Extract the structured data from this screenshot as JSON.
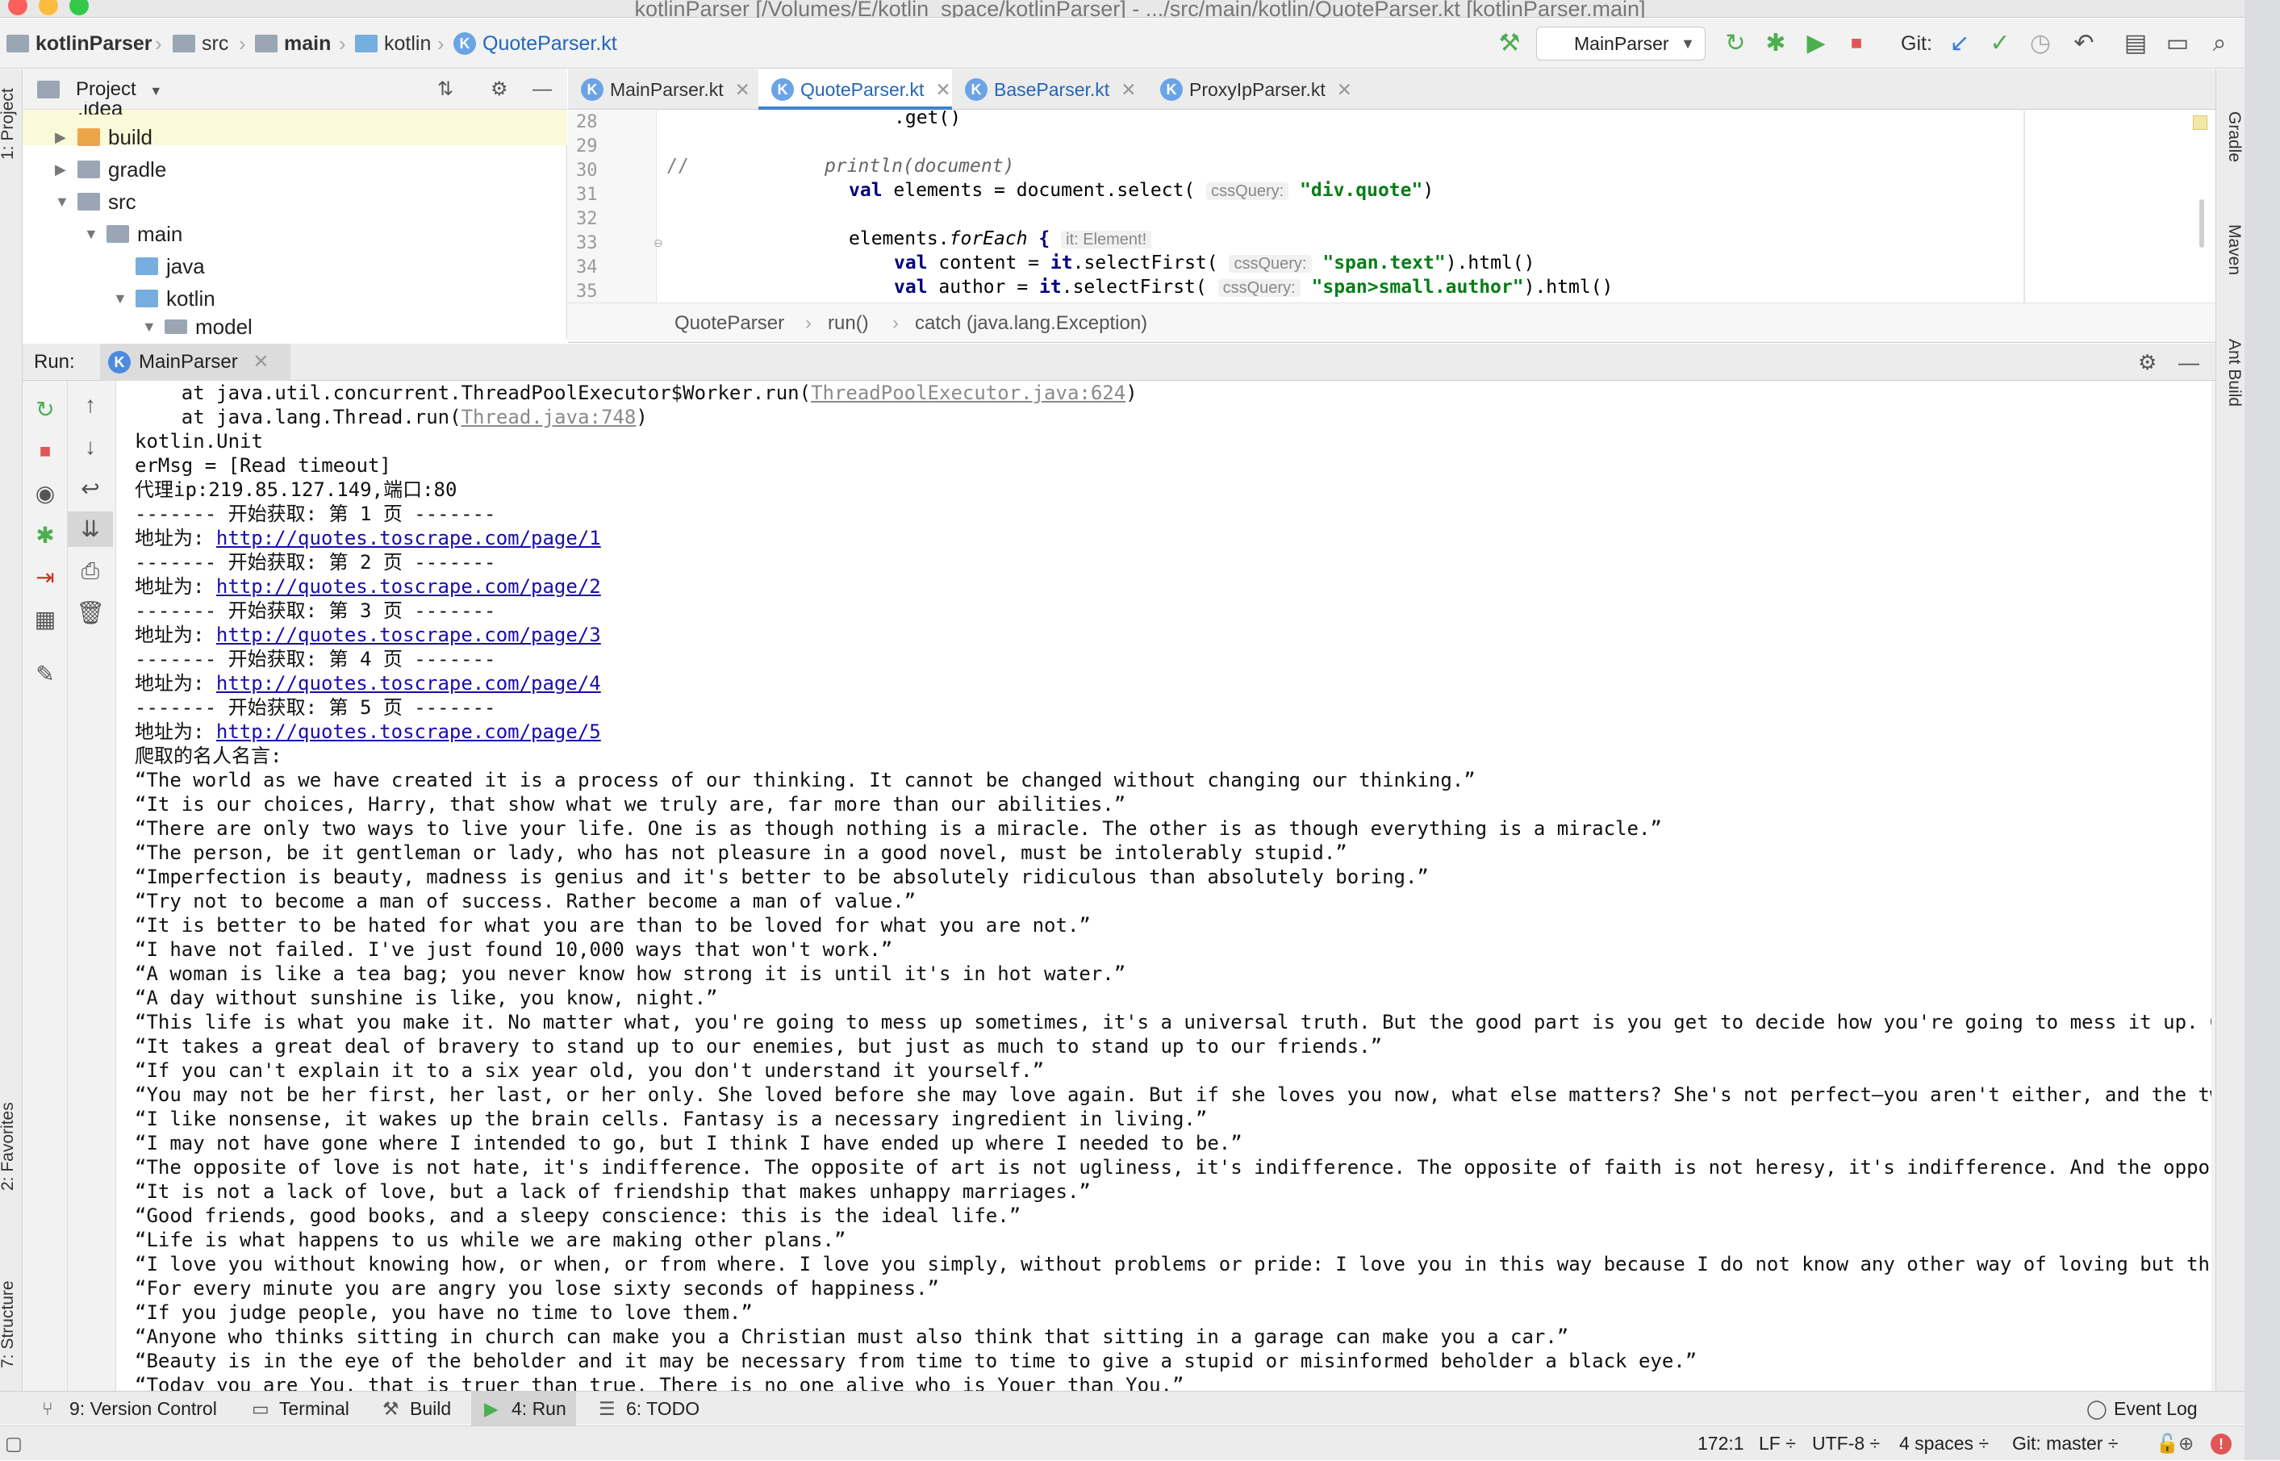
{
  "window": {
    "title": "kotlinParser [/Volumes/E/kotlin_space/kotlinParser] - .../src/main/kotlin/QuoteParser.kt [kotlinParser.main]"
  },
  "nav": {
    "project": "kotlinParser",
    "crumbs": [
      "src",
      "main",
      "kotlin",
      "QuoteParser.kt"
    ]
  },
  "toolbar": {
    "run_config": "MainParser",
    "git_label": "Git:"
  },
  "left_strip": {
    "project": "1: Project",
    "favorites": "2: Favorites",
    "structure": "7: Structure"
  },
  "right_strip": {
    "gradle": "Gradle",
    "maven": "Maven",
    "ant": "Ant Build"
  },
  "project": {
    "title": "Project",
    "tree": [
      {
        "label": ".idea",
        "type": "folder"
      },
      {
        "label": "build",
        "type": "folder-orange"
      },
      {
        "label": "gradle",
        "type": "folder"
      },
      {
        "label": "src",
        "type": "folder"
      },
      {
        "label": "main",
        "type": "folder"
      },
      {
        "label": "java",
        "type": "folder-blue"
      },
      {
        "label": "kotlin",
        "type": "folder-blue"
      },
      {
        "label": "model",
        "type": "package"
      }
    ]
  },
  "editor": {
    "tabs": [
      "MainParser.kt",
      "QuoteParser.kt",
      "BaseParser.kt",
      "ProxyIpParser.kt"
    ],
    "active_tab": 1,
    "line_numbers": [
      "28",
      "29",
      "30",
      "31",
      "32",
      "33",
      "34",
      "35"
    ],
    "code": {
      "l28": ".get()",
      "l30_comment": "//",
      "l30_code": "println(document)",
      "l31_kw": "val",
      "l31_a": "elements = document.select(",
      "l31_hint": "cssQuery:",
      "l31_str": "\"div.quote\"",
      "l31_b": ")",
      "l33_a": "elements.",
      "l33_fn": "forEach",
      "l33_b": " {",
      "l33_hint": "it: Element!",
      "l34_kw": "val",
      "l34_a": "content = ",
      "l34_it": "it",
      "l34_b": ".selectFirst(",
      "l34_hint": "cssQuery:",
      "l34_str": "\"span.text\"",
      "l34_c": ").html()",
      "l35_kw": "val",
      "l35_a": "author = ",
      "l35_it": "it",
      "l35_b": ".selectFirst(",
      "l35_hint": "cssQuery:",
      "l35_str": "\"span>small.author\"",
      "l35_c": ").html()"
    },
    "breadcrumb": [
      "QuoteParser",
      "run()",
      "catch (java.lang.Exception)"
    ]
  },
  "run": {
    "label": "Run:",
    "tab": "MainParser",
    "console": [
      {
        "pre": "    at java.util.concurrent.ThreadPoolExecutor$Worker.run(",
        "link": "ThreadPoolExecutor.java:624",
        "post": ")",
        "style": "gray"
      },
      {
        "pre": "    at java.lang.Thread.run(",
        "link": "Thread.java:748",
        "post": ")",
        "style": "gray"
      },
      {
        "pre": "kotlin.Unit"
      },
      {
        "pre": "erMsg = [Read timeout]"
      },
      {
        "pre": "代理ip:219.85.127.149,端口:80"
      },
      {
        "pre": "------- 开始获取: 第 1 页 -------"
      },
      {
        "pre": "地址为: ",
        "link": "http://quotes.toscrape.com/page/1",
        "style": "link"
      },
      {
        "pre": "------- 开始获取: 第 2 页 -------"
      },
      {
        "pre": "地址为: ",
        "link": "http://quotes.toscrape.com/page/2",
        "style": "link"
      },
      {
        "pre": "------- 开始获取: 第 3 页 -------"
      },
      {
        "pre": "地址为: ",
        "link": "http://quotes.toscrape.com/page/3",
        "style": "link"
      },
      {
        "pre": "------- 开始获取: 第 4 页 -------"
      },
      {
        "pre": "地址为: ",
        "link": "http://quotes.toscrape.com/page/4",
        "style": "link"
      },
      {
        "pre": "------- 开始获取: 第 5 页 -------"
      },
      {
        "pre": "地址为: ",
        "link": "http://quotes.toscrape.com/page/5",
        "style": "link"
      },
      {
        "pre": "爬取的名人名言:"
      },
      {
        "pre": "“The world as we have created it is a process of our thinking. It cannot be changed without changing our thinking.”"
      },
      {
        "pre": "“It is our choices, Harry, that show what we truly are, far more than our abilities.”"
      },
      {
        "pre": "“There are only two ways to live your life. One is as though nothing is a miracle. The other is as though everything is a miracle.”"
      },
      {
        "pre": "“The person, be it gentleman or lady, who has not pleasure in a good novel, must be intolerably stupid.”"
      },
      {
        "pre": "“Imperfection is beauty, madness is genius and it's better to be absolutely ridiculous than absolutely boring.”"
      },
      {
        "pre": "“Try not to become a man of success. Rather become a man of value.”"
      },
      {
        "pre": "“It is better to be hated for what you are than to be loved for what you are not.”"
      },
      {
        "pre": "“I have not failed. I've just found 10,000 ways that won't work.”"
      },
      {
        "pre": "“A woman is like a tea bag; you never know how strong it is until it's in hot water.”"
      },
      {
        "pre": "“A day without sunshine is like, you know, night.”"
      },
      {
        "pre": "“This life is what you make it. No matter what, you're going to mess up sometimes, it's a universal truth. But the good part is you get to decide how you're going to mess it up. Girls w"
      },
      {
        "pre": "“It takes a great deal of bravery to stand up to our enemies, but just as much to stand up to our friends.”"
      },
      {
        "pre": "“If you can't explain it to a six year old, you don't understand it yourself.”"
      },
      {
        "pre": "“You may not be her first, her last, or her only. She loved before she may love again. But if she loves you now, what else matters? She's not perfect—you aren't either, and the two of y"
      },
      {
        "pre": "“I like nonsense, it wakes up the brain cells. Fantasy is a necessary ingredient in living.”"
      },
      {
        "pre": "“I may not have gone where I intended to go, but I think I have ended up where I needed to be.”"
      },
      {
        "pre": "“The opposite of love is not hate, it's indifference. The opposite of art is not ugliness, it's indifference. The opposite of faith is not heresy, it's indifference. And the opposite of"
      },
      {
        "pre": "“It is not a lack of love, but a lack of friendship that makes unhappy marriages.”"
      },
      {
        "pre": "“Good friends, good books, and a sleepy conscience: this is the ideal life.”"
      },
      {
        "pre": "“Life is what happens to us while we are making other plans.”"
      },
      {
        "pre": "“I love you without knowing how, or when, or from where. I love you simply, without problems or pride: I love you in this way because I do not know any other way of loving but this, in"
      },
      {
        "pre": "“For every minute you are angry you lose sixty seconds of happiness.”"
      },
      {
        "pre": "“If you judge people, you have no time to love them.”"
      },
      {
        "pre": "“Anyone who thinks sitting in church can make you a Christian must also think that sitting in a garage can make you a car.”"
      },
      {
        "pre": "“Beauty is in the eye of the beholder and it may be necessary from time to time to give a stupid or misinformed beholder a black eye.”"
      },
      {
        "pre": "“Today you are You, that is truer than true. There is no one alive who is Youer than You.”"
      }
    ]
  },
  "bottom_tabs": {
    "version_control": "9: Version Control",
    "terminal": "Terminal",
    "build": "Build",
    "run": "4: Run",
    "todo": "6: TODO",
    "event_log": "Event Log"
  },
  "status": {
    "position": "172:1",
    "line_sep": "LF ÷",
    "encoding": "UTF-8 ÷",
    "indent": "4 spaces ÷",
    "git": "Git: master ÷"
  }
}
